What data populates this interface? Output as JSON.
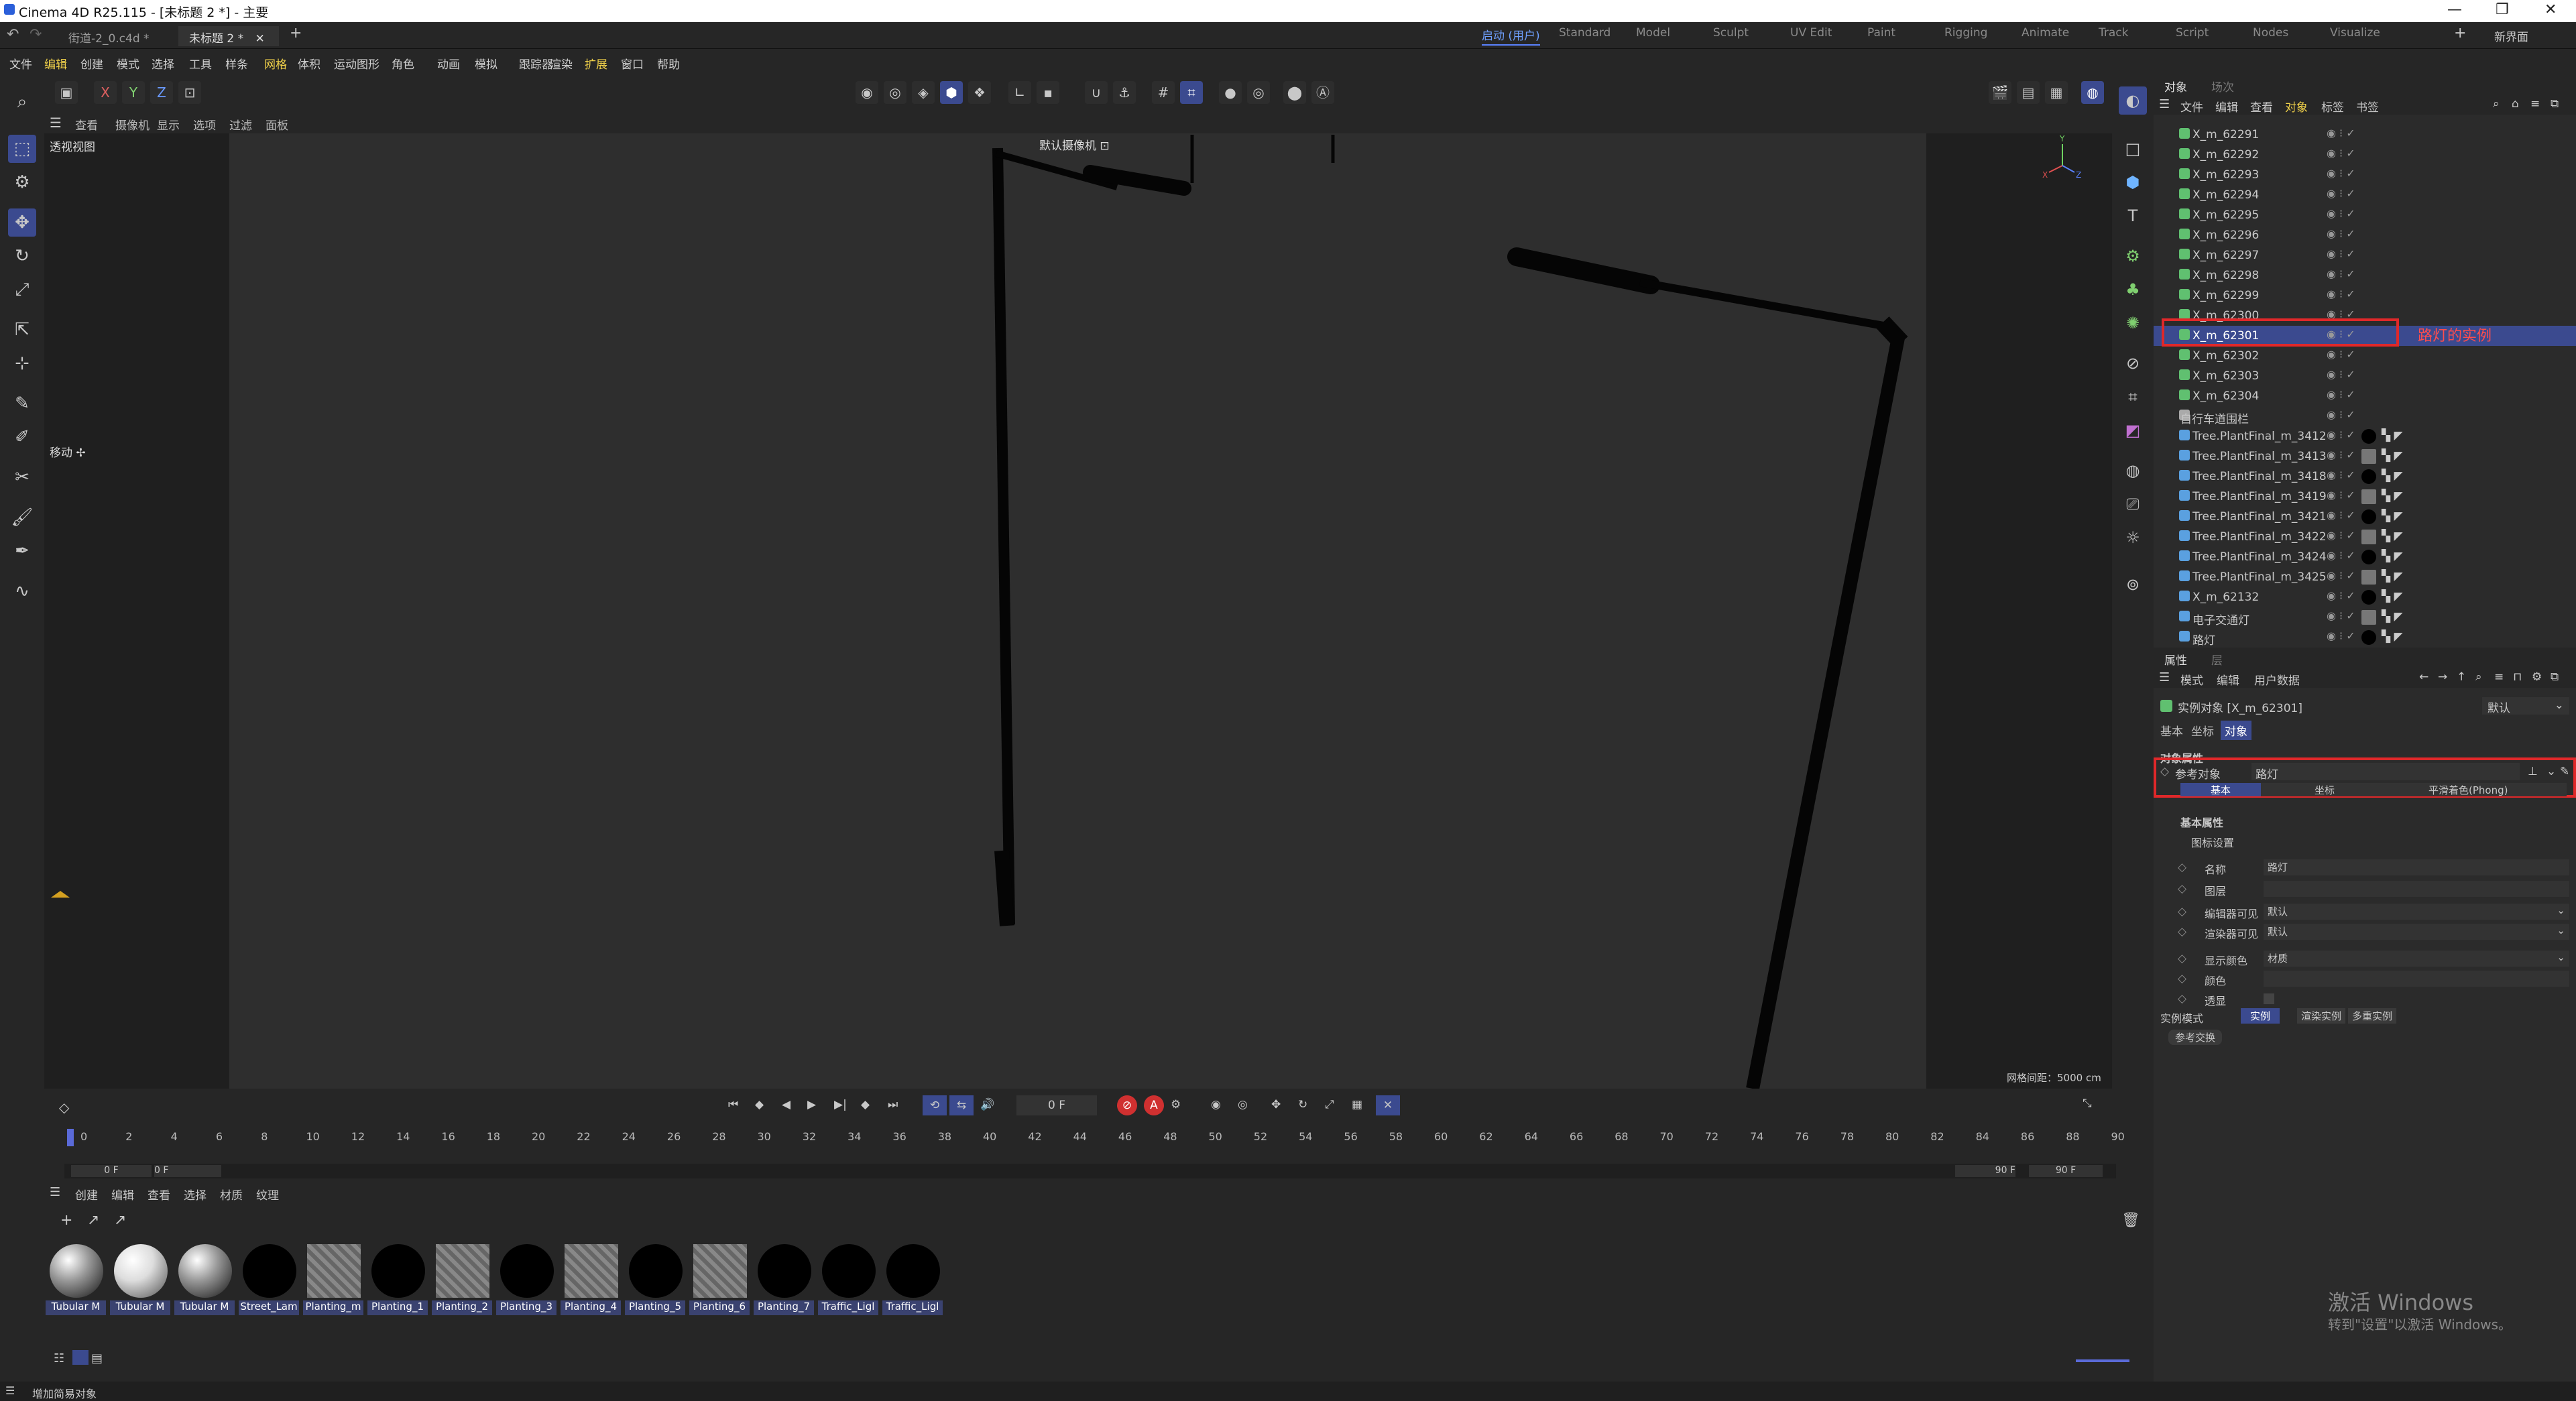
{
  "titlebar": {
    "title": "Cinema 4D R25.115 - [未标题 2 *] - 主要",
    "min": "—",
    "max": "❐",
    "close": "✕"
  },
  "doc_tabs": [
    {
      "label": "街道-2_0.c4d *"
    },
    {
      "label": "未标题 2 *",
      "close": "✕"
    }
  ],
  "new_tab": "+",
  "layouts": [
    "启动 (用户)",
    "Standard",
    "Model",
    "Sculpt",
    "UV Edit",
    "Paint",
    "Rigging",
    "Animate",
    "Track",
    "Script",
    "Nodes",
    "Visualize"
  ],
  "new_layout": "新界面",
  "menus": [
    "文件",
    "编辑",
    "创建",
    "模式",
    "选择",
    "工具",
    "样条",
    "网格",
    "体积",
    "运动图形",
    "角色",
    "动画",
    "模拟",
    "跟踪器",
    "渲染",
    "扩展",
    "窗口",
    "帮助"
  ],
  "toolbar": {
    "x": "X",
    "y": "Y",
    "z": "Z"
  },
  "view_menu": [
    "查看",
    "摄像机",
    "显示",
    "选项",
    "过滤",
    "面板"
  ],
  "viewport": {
    "label": "透视视图",
    "camera": "默认摄像机 ⊡",
    "move_label": "移动 ✢",
    "grid": "网格间距：5000 cm",
    "axis_x": "X",
    "axis_y": "Y",
    "axis_z": "Z"
  },
  "object_manager": {
    "tabs": [
      "对象",
      "场次"
    ],
    "menu": [
      "文件",
      "编辑",
      "查看",
      "对象",
      "标签",
      "书签"
    ],
    "rows": [
      {
        "name": "X_m_62291"
      },
      {
        "name": "X_m_62292"
      },
      {
        "name": "X_m_62293"
      },
      {
        "name": "X_m_62294"
      },
      {
        "name": "X_m_62295"
      },
      {
        "name": "X_m_62296"
      },
      {
        "name": "X_m_62297"
      },
      {
        "name": "X_m_62298"
      },
      {
        "name": "X_m_62299"
      },
      {
        "name": "X_m_62300"
      },
      {
        "name": "X_m_62301"
      },
      {
        "name": "X_m_62302"
      },
      {
        "name": "X_m_62303"
      },
      {
        "name": "X_m_62304"
      },
      {
        "name": "自行车道围栏"
      },
      {
        "name": "Tree.PlantFinal_m_3412"
      },
      {
        "name": "Tree.PlantFinal_m_3413"
      },
      {
        "name": "Tree.PlantFinal_m_3418"
      },
      {
        "name": "Tree.PlantFinal_m_3419"
      },
      {
        "name": "Tree.PlantFinal_m_3421"
      },
      {
        "name": "Tree.PlantFinal_m_3422"
      },
      {
        "name": "Tree.PlantFinal_m_3424"
      },
      {
        "name": "Tree.PlantFinal_m_3425"
      },
      {
        "name": "X_m_62132"
      },
      {
        "name": "电子交通灯"
      },
      {
        "name": "路灯"
      }
    ],
    "annotation": "路灯的实例"
  },
  "attributes": {
    "tabs": [
      "属性",
      "层"
    ],
    "menu": [
      "模式",
      "编辑",
      "用户数据"
    ],
    "object_title": "实例对象 [X_m_62301]",
    "preset": "默认",
    "subtabs": [
      "基本",
      "坐标",
      "对象"
    ],
    "section": "对象属性",
    "ref_label": "参考对象",
    "ref_value": "路灯",
    "inner_tabs": [
      "基本",
      "坐标",
      "平滑着色(Phong)"
    ],
    "basic_title": "基本属性",
    "icon_settings": "图标设置",
    "name_label": "名称",
    "name_value": "路灯",
    "layer_label": "图层",
    "editor_vis_label": "编辑器可见",
    "editor_vis_value": "默认",
    "render_vis_label": "渲染器可见",
    "render_vis_value": "默认",
    "color_label": "显示颜色",
    "color_value": "材质",
    "col_label": "颜色",
    "xray_label": "透显",
    "mode_label": "实例模式",
    "modes": [
      "实例",
      "渲染实例",
      "多重实例"
    ],
    "convert": "参考交换"
  },
  "timeline": {
    "frame": "0 F",
    "start": "0 F",
    "start2": "0 F",
    "end": "90 F",
    "end2": "90 F",
    "ticks": [
      "0",
      "2",
      "4",
      "6",
      "8",
      "10",
      "12",
      "14",
      "16",
      "18",
      "20",
      "22",
      "24",
      "26",
      "28",
      "30",
      "32",
      "34",
      "36",
      "38",
      "40",
      "42",
      "44",
      "46",
      "48",
      "50",
      "52",
      "54",
      "56",
      "58",
      "60",
      "62",
      "64",
      "66",
      "68",
      "70",
      "72",
      "74",
      "76",
      "78",
      "80",
      "82",
      "84",
      "86",
      "88",
      "90"
    ]
  },
  "materials_panel": {
    "menu": [
      "创建",
      "编辑",
      "查看",
      "选择",
      "材质",
      "纹理"
    ],
    "items": [
      {
        "label": "Tubular M",
        "style": "grey"
      },
      {
        "label": "Tubular M",
        "style": "white"
      },
      {
        "label": "Tubular M",
        "style": "grey"
      },
      {
        "label": "Street_Lam",
        "style": "black"
      },
      {
        "label": "Planting_m",
        "style": "check"
      },
      {
        "label": "Planting_1",
        "style": "black"
      },
      {
        "label": "Planting_2",
        "style": "check"
      },
      {
        "label": "Planting_3",
        "style": "black"
      },
      {
        "label": "Planting_4",
        "style": "check"
      },
      {
        "label": "Planting_5",
        "style": "black"
      },
      {
        "label": "Planting_6",
        "style": "check"
      },
      {
        "label": "Planting_7",
        "style": "black"
      },
      {
        "label": "Traffic_Ligl",
        "style": "black"
      },
      {
        "label": "Traffic_Ligl",
        "style": "black"
      }
    ]
  },
  "watermark": {
    "line1": "激活 Windows",
    "line2": "转到\"设置\"以激活 Windows。"
  },
  "status": "增加简易对象"
}
